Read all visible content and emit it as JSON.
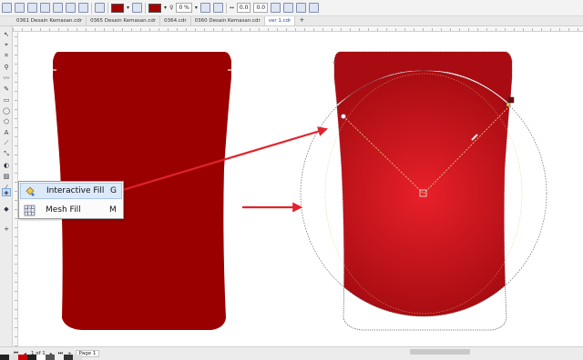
{
  "propbar": {
    "outline_width": "0 %",
    "x_offset": "0.0",
    "y_offset": "0.0",
    "fill_color": "#a40000"
  },
  "tabs": [
    {
      "label": "0361 Desain Kemasan.cdr",
      "active": false
    },
    {
      "label": "0365 Desain Kemasan.cdr",
      "active": false
    },
    {
      "label": "0364.cdr",
      "active": false
    },
    {
      "label": "0360 Desain Kemasan.cdr",
      "active": false
    },
    {
      "label": "ver 1.cdr",
      "active": true
    }
  ],
  "tab_add": "+",
  "flyout": {
    "items": [
      {
        "label": "Interactive Fill",
        "shortcut": "G",
        "icon": "interactive-fill-icon",
        "highlighted": true
      },
      {
        "label": "Mesh Fill",
        "shortcut": "M",
        "icon": "mesh-fill-icon",
        "highlighted": false
      }
    ]
  },
  "pagebar": {
    "page_count": "1 of 1",
    "page_tab": "Page 1"
  },
  "colors": {
    "left_bag": "#9a0000",
    "gradient_center": "#e8202a",
    "gradient_edge": "#a80c12",
    "arrow": "#e0242c"
  }
}
